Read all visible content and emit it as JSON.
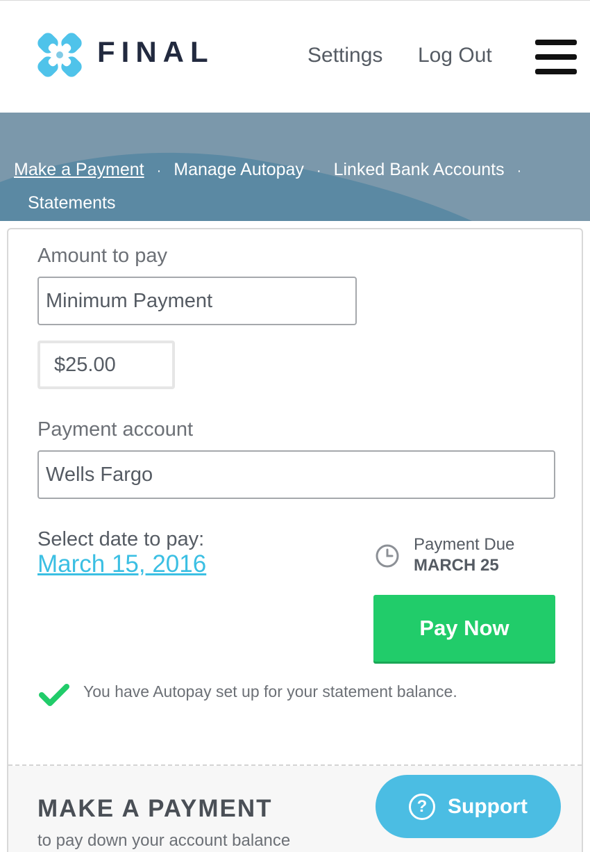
{
  "header": {
    "brand": "FINAL",
    "logo_icon": "logo-knot-icon",
    "nav": {
      "settings": "Settings",
      "logout": "Log Out"
    },
    "menu_icon": "hamburger-menu-icon"
  },
  "subnav": {
    "items": [
      "Make a Payment",
      "Manage Autopay",
      "Linked Bank Accounts",
      "Statements"
    ],
    "active": "Make a Payment",
    "separator": "·"
  },
  "form": {
    "amount_label": "Amount to pay",
    "amount_option": "Minimum Payment",
    "amount_value": "$25.00",
    "account_label": "Payment account",
    "account_value": "Wells Fargo",
    "date_label": "Select date to pay:",
    "date_value": "March 15, 2016",
    "due_label": "Payment Due",
    "due_date": "MARCH 25",
    "pay_button": "Pay Now",
    "autopay_note": "You have Autopay set up for your statement balance."
  },
  "section": {
    "title": "MAKE A PAYMENT",
    "subtitle": "to pay down your account balance"
  },
  "support": {
    "label": "Support",
    "icon": "?"
  },
  "colors": {
    "brand_dark": "#222a3f",
    "logo_blue": "#4fc3ea",
    "banner": "#7b98ab",
    "link_blue": "#3bbfe3",
    "pay_green": "#21cc6a",
    "check_green": "#21cc6a",
    "support_blue": "#4bbde3"
  }
}
